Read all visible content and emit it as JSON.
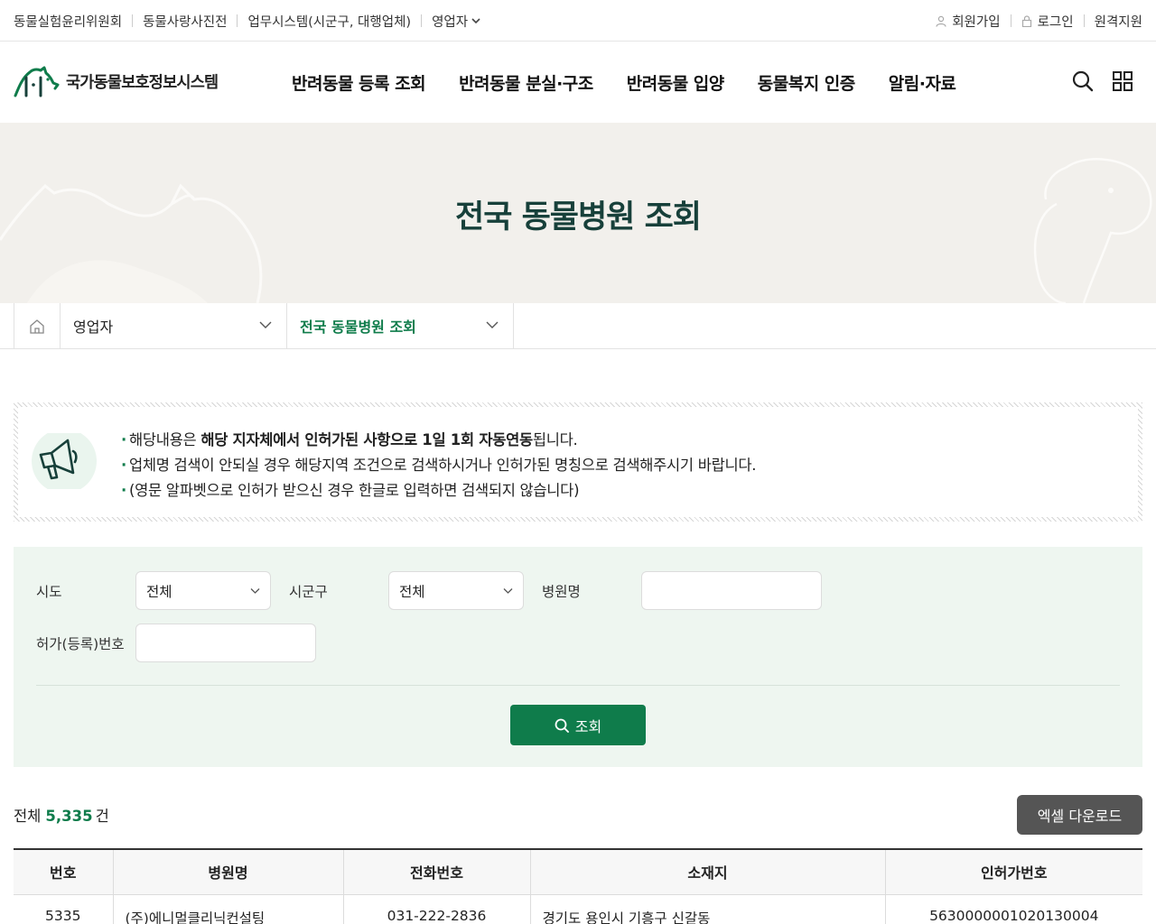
{
  "util_bar": {
    "left_links": [
      "동물실험윤리위원회",
      "동물사랑사진전",
      "업무시스템(시군구, 대행업체)",
      "영업자"
    ],
    "signup": "회원가입",
    "login": "로그인",
    "remote": "원격지원"
  },
  "header": {
    "logo_text": "국가동물보호정보시스템",
    "gnb": [
      "반려동물 등록 조회",
      "반려동물 분실·구조",
      "반려동물 입양",
      "동물복지 인증",
      "알림·자료"
    ]
  },
  "visual": {
    "title": "전국 동물병원 조회"
  },
  "location": {
    "depth1": "영업자",
    "depth2": "전국 동물병원 조회"
  },
  "notice": {
    "line1_pre": "해당내용은 ",
    "line1_bold": "해당 지자체에서 인허가된 사항으로 1일 1회 자동연동",
    "line1_post": "됩니다.",
    "line2": "업체명 검색이 안되실 경우 해당지역 조건으로 검색하시거나 인허가된 명칭으로 검색해주시기 바랍니다.",
    "line3": "(영문 알파벳으로 인허가 받으신 경우 한글로 입력하면 검색되지 않습니다)"
  },
  "search": {
    "sido_label": "시도",
    "sido_value": "전체",
    "sigungu_label": "시군구",
    "sigungu_value": "전체",
    "hospital_label": "병원명",
    "hospital_value": "",
    "license_label": "허가(등록)번호",
    "license_value": "",
    "button": "조회"
  },
  "results": {
    "total_prefix": "전체",
    "total_count": "5,335",
    "total_suffix": "건",
    "excel_button": "엑셀 다운로드",
    "columns": [
      "번호",
      "병원명",
      "전화번호",
      "소재지",
      "인허가번호"
    ],
    "rows": [
      [
        "5335",
        "(주)에니멀클리닉컨설팅",
        "031-222-2836",
        "경기도 용인시 기흥구 신갈동",
        "5630000001020130004"
      ]
    ]
  },
  "colors": {
    "brand_green": "#0f7c4b",
    "title_dark_green": "#17403a",
    "search_bg": "#eef6f0",
    "banner_bg": "#f2f0ec"
  }
}
